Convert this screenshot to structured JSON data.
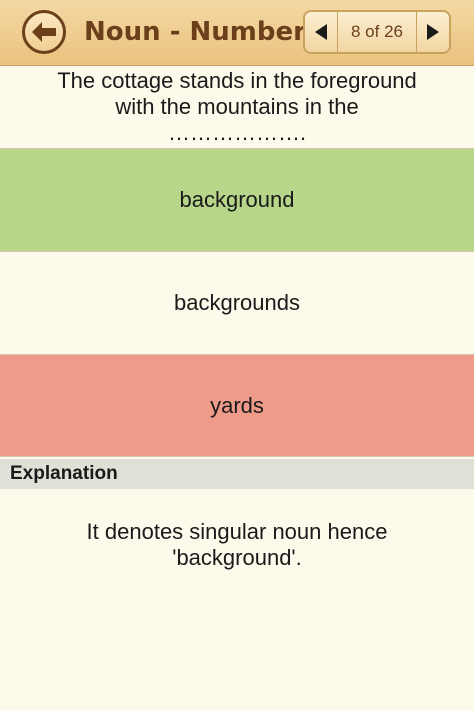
{
  "header": {
    "title": "Noun - Number",
    "pager_text": "8 of 26"
  },
  "question": {
    "lines": [
      "The cottage stands in the foreground",
      "with the mountains in the",
      "………………."
    ]
  },
  "options": [
    {
      "label": "background",
      "state": "correct",
      "color": "#b7d689"
    },
    {
      "label": "backgrounds",
      "state": "neutral",
      "color": "#fdfaeb"
    },
    {
      "label": "yards",
      "state": "wrong",
      "color": "#ef9b8a"
    }
  ],
  "explanation": {
    "heading": "Explanation",
    "lines": [
      "It denotes singular noun hence",
      "'background'."
    ]
  },
  "icons": {
    "back": "arrow-left-icon",
    "prev": "triangle-left-icon",
    "next": "triangle-right-icon"
  },
  "colors": {
    "header_bg": "#efce92",
    "header_text": "#6b3f19",
    "page_bg": "#fdfaeb",
    "correct": "#b7d689",
    "wrong": "#ef9b8a",
    "explanation_bar": "#e1e0d6"
  }
}
